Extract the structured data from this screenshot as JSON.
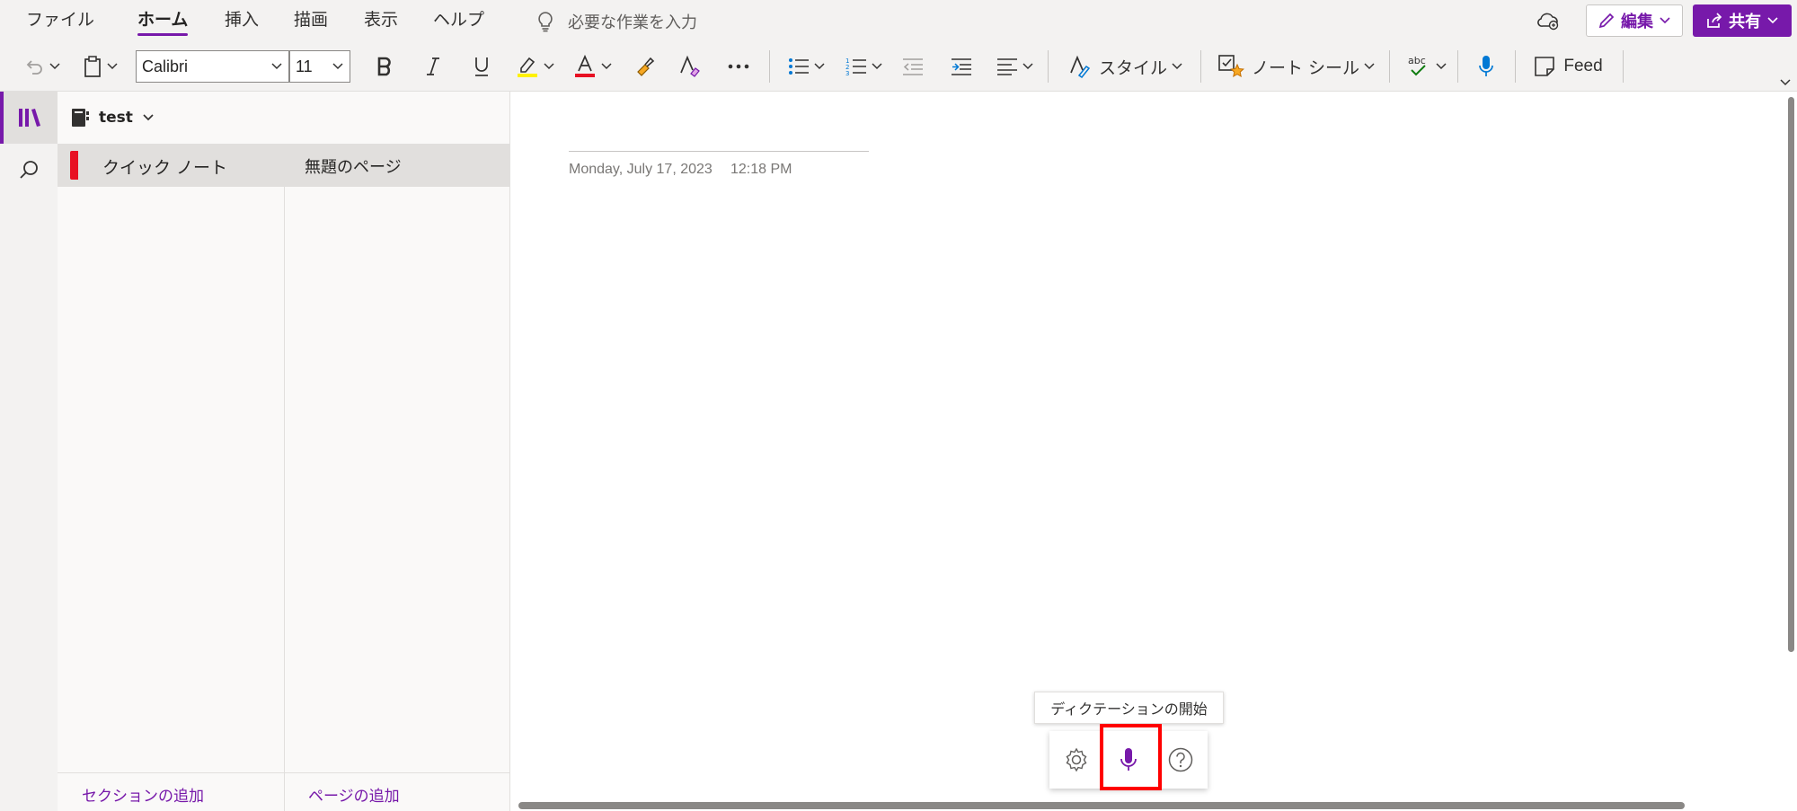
{
  "menu": {
    "tabs": [
      {
        "label": "ファイル"
      },
      {
        "label": "ホーム"
      },
      {
        "label": "挿入"
      },
      {
        "label": "描画"
      },
      {
        "label": "表示"
      },
      {
        "label": "ヘルプ"
      }
    ],
    "active_tab": "ホーム",
    "tell_me_placeholder": "必要な作業を入力",
    "edit_label": "編集",
    "share_label": "共有"
  },
  "toolbar": {
    "font_name": "Calibri",
    "font_size": "11",
    "styles_label": "スタイル",
    "tags_label": "ノート シール",
    "spelling_text": "abc",
    "feed_label": "Feed"
  },
  "notebook": {
    "name": "test"
  },
  "sections": [
    {
      "label": "クイック ノート",
      "color": "#e81123"
    }
  ],
  "pages": [
    {
      "label": "無題のページ"
    }
  ],
  "nav_footer": {
    "add_section": "セクションの追加",
    "add_page": "ページの追加"
  },
  "page": {
    "date": "Monday, July 17, 2023",
    "time": "12:18 PM"
  },
  "dictation": {
    "tooltip": "ディクテーションの開始"
  },
  "colors": {
    "accent": "#7719aa",
    "highlight": "#ff0000",
    "highlighter_color": "#fff100",
    "font_color": "#e81123"
  }
}
